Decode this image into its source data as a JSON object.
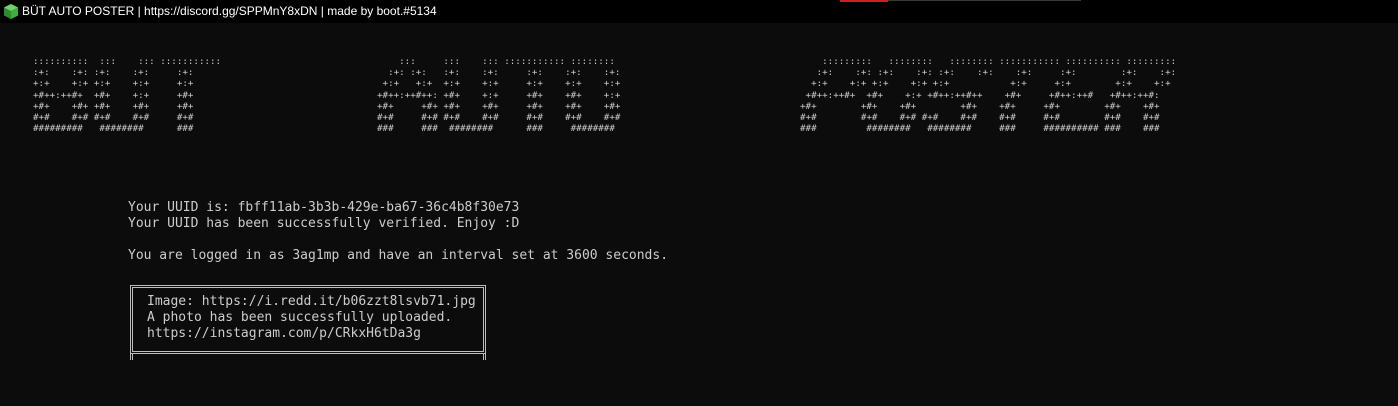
{
  "window": {
    "title": "BÜT AUTO POSTER | https://discord.gg/SPPMnY8xDN | made by boot.#5134",
    "icon": "green-cube-icon",
    "background_color": "#0c0c0c",
    "text_color": "#cccccc"
  },
  "banner": {
    "left_block": "::::::::::  :::    ::: :::::::::::\n:+:    :+: :+:    :+:     :+:\n+:+    +:+ +:+    +:+     +:+\n+#++:++#+  +#+    +:+     +#+\n+#+    +#+ +#+    +#+     +#+\n#+#    #+# #+#    #+#     #+#\n#########   ########      ###",
    "middle_block": "    :::     :::    ::: ::::::::::: ::::::::\n  :+: :+:   :+:    :+:     :+:    :+:    :+:\n +:+   +:+  +:+    +:+     +:+    +:+    +:+\n+#++:++#++: +#+    +:+     +#+    +#+    +:+\n+#+     +#+ +#+    +#+     +#+    +#+    +#+\n#+#     #+# #+#    #+#     #+#    #+#    #+#\n###     ###  ########      ###     ########",
    "right_block": "    :::::::::   ::::::::   :::::::: ::::::::::: :::::::::: :::::::::\n   :+:    :+: :+:    :+: :+:    :+:    :+:     :+:        :+:    :+:\n  +:+    +:+ +:+    +:+ +:+           +:+     +:+        +:+    +:+\n +#++:++#+  +#+    +:+ +#++:++#++    +#+     +#++:++#   +#++:++#:\n+#+        +#+    +#+        +#+    +#+     +#+        +#+    +#+\n#+#        #+#    #+# #+#    #+#    #+#     #+#        #+#    #+#\n###         ########   ########     ###     ########## ###    ###"
  },
  "status": {
    "uuid_line": "Your UUID is: fbff11ab-3b3b-429e-ba67-36c4b8f30e73",
    "verified_line": "Your UUID has been successfully verified. Enjoy :D",
    "login_line": "You are logged in as 3ag1mp and have an interval set at 3600 seconds."
  },
  "upload_box": {
    "image_line": "Image: https://i.redd.it/b06zzt8lsvb71.jpg",
    "uploaded_line": "A photo has been successfully uploaded.",
    "instagram_line": "https://instagram.com/p/CRkxH6tDa3g"
  },
  "colors": {
    "title_accent": "#cc1f1f",
    "icon_green": "#3fae3f",
    "box_border": "#bcbcbc"
  }
}
